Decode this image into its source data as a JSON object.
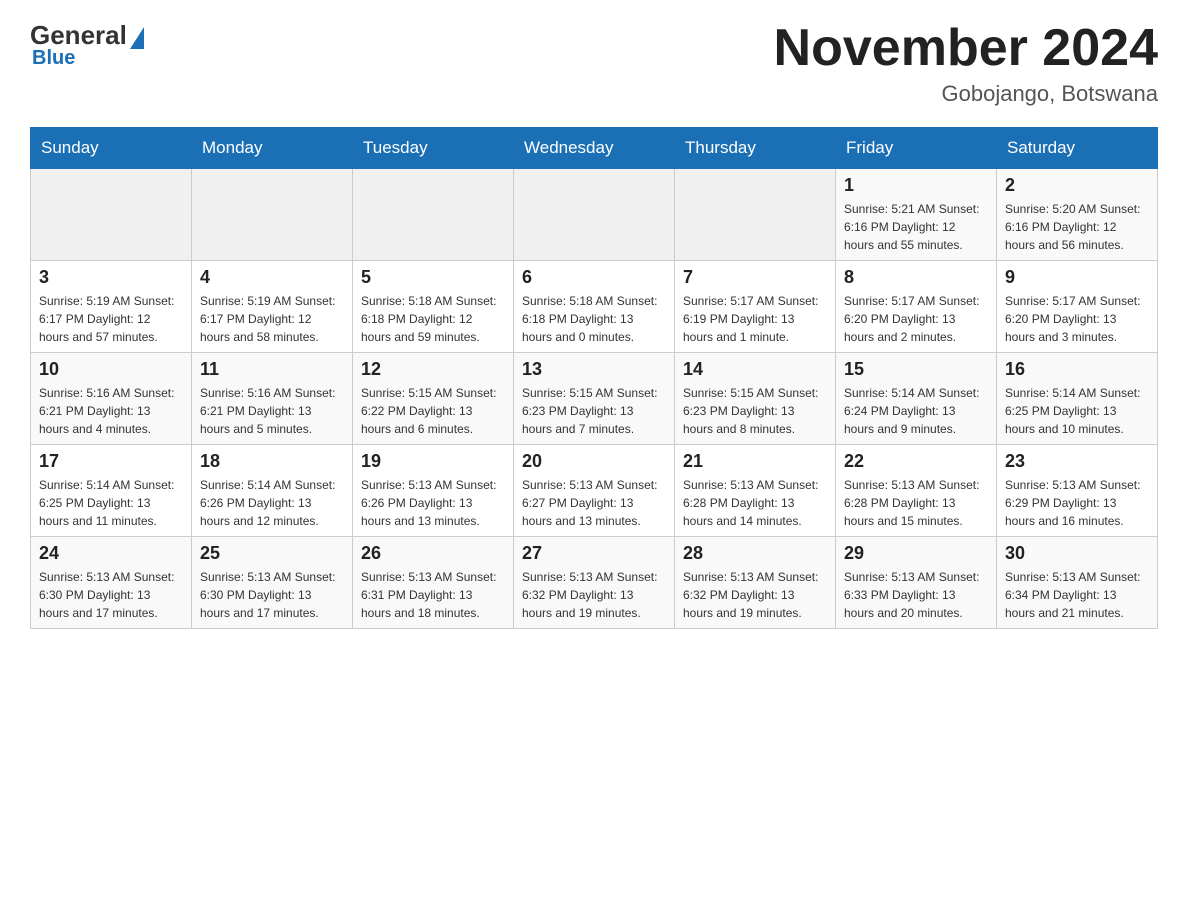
{
  "header": {
    "logo_general": "General",
    "logo_blue": "Blue",
    "month_title": "November 2024",
    "location": "Gobojango, Botswana"
  },
  "days_of_week": [
    "Sunday",
    "Monday",
    "Tuesday",
    "Wednesday",
    "Thursday",
    "Friday",
    "Saturday"
  ],
  "weeks": [
    {
      "days": [
        {
          "number": "",
          "info": ""
        },
        {
          "number": "",
          "info": ""
        },
        {
          "number": "",
          "info": ""
        },
        {
          "number": "",
          "info": ""
        },
        {
          "number": "",
          "info": ""
        },
        {
          "number": "1",
          "info": "Sunrise: 5:21 AM\nSunset: 6:16 PM\nDaylight: 12 hours\nand 55 minutes."
        },
        {
          "number": "2",
          "info": "Sunrise: 5:20 AM\nSunset: 6:16 PM\nDaylight: 12 hours\nand 56 minutes."
        }
      ]
    },
    {
      "days": [
        {
          "number": "3",
          "info": "Sunrise: 5:19 AM\nSunset: 6:17 PM\nDaylight: 12 hours\nand 57 minutes."
        },
        {
          "number": "4",
          "info": "Sunrise: 5:19 AM\nSunset: 6:17 PM\nDaylight: 12 hours\nand 58 minutes."
        },
        {
          "number": "5",
          "info": "Sunrise: 5:18 AM\nSunset: 6:18 PM\nDaylight: 12 hours\nand 59 minutes."
        },
        {
          "number": "6",
          "info": "Sunrise: 5:18 AM\nSunset: 6:18 PM\nDaylight: 13 hours\nand 0 minutes."
        },
        {
          "number": "7",
          "info": "Sunrise: 5:17 AM\nSunset: 6:19 PM\nDaylight: 13 hours\nand 1 minute."
        },
        {
          "number": "8",
          "info": "Sunrise: 5:17 AM\nSunset: 6:20 PM\nDaylight: 13 hours\nand 2 minutes."
        },
        {
          "number": "9",
          "info": "Sunrise: 5:17 AM\nSunset: 6:20 PM\nDaylight: 13 hours\nand 3 minutes."
        }
      ]
    },
    {
      "days": [
        {
          "number": "10",
          "info": "Sunrise: 5:16 AM\nSunset: 6:21 PM\nDaylight: 13 hours\nand 4 minutes."
        },
        {
          "number": "11",
          "info": "Sunrise: 5:16 AM\nSunset: 6:21 PM\nDaylight: 13 hours\nand 5 minutes."
        },
        {
          "number": "12",
          "info": "Sunrise: 5:15 AM\nSunset: 6:22 PM\nDaylight: 13 hours\nand 6 minutes."
        },
        {
          "number": "13",
          "info": "Sunrise: 5:15 AM\nSunset: 6:23 PM\nDaylight: 13 hours\nand 7 minutes."
        },
        {
          "number": "14",
          "info": "Sunrise: 5:15 AM\nSunset: 6:23 PM\nDaylight: 13 hours\nand 8 minutes."
        },
        {
          "number": "15",
          "info": "Sunrise: 5:14 AM\nSunset: 6:24 PM\nDaylight: 13 hours\nand 9 minutes."
        },
        {
          "number": "16",
          "info": "Sunrise: 5:14 AM\nSunset: 6:25 PM\nDaylight: 13 hours\nand 10 minutes."
        }
      ]
    },
    {
      "days": [
        {
          "number": "17",
          "info": "Sunrise: 5:14 AM\nSunset: 6:25 PM\nDaylight: 13 hours\nand 11 minutes."
        },
        {
          "number": "18",
          "info": "Sunrise: 5:14 AM\nSunset: 6:26 PM\nDaylight: 13 hours\nand 12 minutes."
        },
        {
          "number": "19",
          "info": "Sunrise: 5:13 AM\nSunset: 6:26 PM\nDaylight: 13 hours\nand 13 minutes."
        },
        {
          "number": "20",
          "info": "Sunrise: 5:13 AM\nSunset: 6:27 PM\nDaylight: 13 hours\nand 13 minutes."
        },
        {
          "number": "21",
          "info": "Sunrise: 5:13 AM\nSunset: 6:28 PM\nDaylight: 13 hours\nand 14 minutes."
        },
        {
          "number": "22",
          "info": "Sunrise: 5:13 AM\nSunset: 6:28 PM\nDaylight: 13 hours\nand 15 minutes."
        },
        {
          "number": "23",
          "info": "Sunrise: 5:13 AM\nSunset: 6:29 PM\nDaylight: 13 hours\nand 16 minutes."
        }
      ]
    },
    {
      "days": [
        {
          "number": "24",
          "info": "Sunrise: 5:13 AM\nSunset: 6:30 PM\nDaylight: 13 hours\nand 17 minutes."
        },
        {
          "number": "25",
          "info": "Sunrise: 5:13 AM\nSunset: 6:30 PM\nDaylight: 13 hours\nand 17 minutes."
        },
        {
          "number": "26",
          "info": "Sunrise: 5:13 AM\nSunset: 6:31 PM\nDaylight: 13 hours\nand 18 minutes."
        },
        {
          "number": "27",
          "info": "Sunrise: 5:13 AM\nSunset: 6:32 PM\nDaylight: 13 hours\nand 19 minutes."
        },
        {
          "number": "28",
          "info": "Sunrise: 5:13 AM\nSunset: 6:32 PM\nDaylight: 13 hours\nand 19 minutes."
        },
        {
          "number": "29",
          "info": "Sunrise: 5:13 AM\nSunset: 6:33 PM\nDaylight: 13 hours\nand 20 minutes."
        },
        {
          "number": "30",
          "info": "Sunrise: 5:13 AM\nSunset: 6:34 PM\nDaylight: 13 hours\nand 21 minutes."
        }
      ]
    }
  ]
}
